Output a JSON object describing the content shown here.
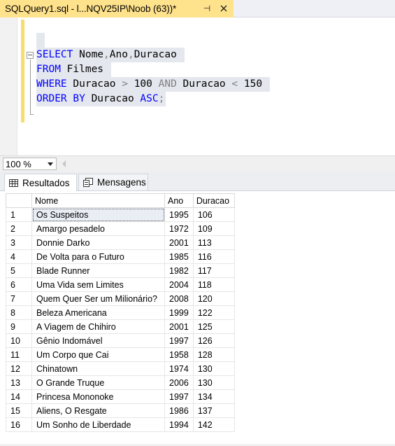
{
  "tab": {
    "title": "SQLQuery1.sql - l...NQV25IP\\Noob (63))*",
    "pin_icon": "pin-icon",
    "close_icon": "close-icon"
  },
  "editor": {
    "lines": [
      [
        {
          "t": "SELECT",
          "c": "kw"
        },
        {
          "t": " Nome",
          "c": "ident"
        },
        {
          "t": ",",
          "c": "gr"
        },
        {
          "t": "Ano",
          "c": "ident"
        },
        {
          "t": ",",
          "c": "gr"
        },
        {
          "t": "Duracao ",
          "c": "ident"
        }
      ],
      [
        {
          "t": "FROM",
          "c": "kw"
        },
        {
          "t": " Filmes ",
          "c": "ident"
        }
      ],
      [
        {
          "t": "WHERE",
          "c": "kw"
        },
        {
          "t": " Duracao ",
          "c": "ident"
        },
        {
          "t": ">",
          "c": "gr"
        },
        {
          "t": " 100 ",
          "c": "ident"
        },
        {
          "t": "AND",
          "c": "gr"
        },
        {
          "t": " Duracao ",
          "c": "ident"
        },
        {
          "t": "<",
          "c": "gr"
        },
        {
          "t": " 150 ",
          "c": "ident"
        }
      ],
      [
        {
          "t": "ORDER BY",
          "c": "kw"
        },
        {
          "t": " Duracao ",
          "c": "ident"
        },
        {
          "t": "ASC",
          "c": "kw"
        },
        {
          "t": ";",
          "c": "gr"
        }
      ]
    ],
    "colors": {
      "keyword": "#0000ff",
      "operator": "#808080",
      "selection": "#e4e7ee",
      "changed_bar": "#f7dc6f"
    }
  },
  "zoom": {
    "value": "100 %"
  },
  "results_tabs": {
    "results": "Resultados",
    "messages": "Mensagens"
  },
  "grid": {
    "columns": [
      "Nome",
      "Ano",
      "Duracao"
    ],
    "rows": [
      [
        "1",
        "Os Suspeitos",
        "1995",
        "106"
      ],
      [
        "2",
        "Amargo pesadelo",
        "1972",
        "109"
      ],
      [
        "3",
        "Donnie Darko",
        "2001",
        "113"
      ],
      [
        "4",
        "De Volta para o Futuro",
        "1985",
        "116"
      ],
      [
        "5",
        "Blade Runner",
        "1982",
        "117"
      ],
      [
        "6",
        "Uma Vida sem Limites",
        "2004",
        "118"
      ],
      [
        "7",
        "Quem Quer Ser um Milionário?",
        "2008",
        "120"
      ],
      [
        "8",
        "Beleza Americana",
        "1999",
        "122"
      ],
      [
        "9",
        "A Viagem de Chihiro",
        "2001",
        "125"
      ],
      [
        "10",
        "Gênio Indomável",
        "1997",
        "126"
      ],
      [
        "11",
        "Um Corpo que Cai",
        "1958",
        "128"
      ],
      [
        "12",
        "Chinatown",
        "1974",
        "130"
      ],
      [
        "13",
        "O Grande Truque",
        "2006",
        "130"
      ],
      [
        "14",
        "Princesa Mononoke",
        "1997",
        "134"
      ],
      [
        "15",
        "Aliens, O Resgate",
        "1986",
        "137"
      ],
      [
        "16",
        "Um Sonho de Liberdade",
        "1994",
        "142"
      ]
    ]
  }
}
